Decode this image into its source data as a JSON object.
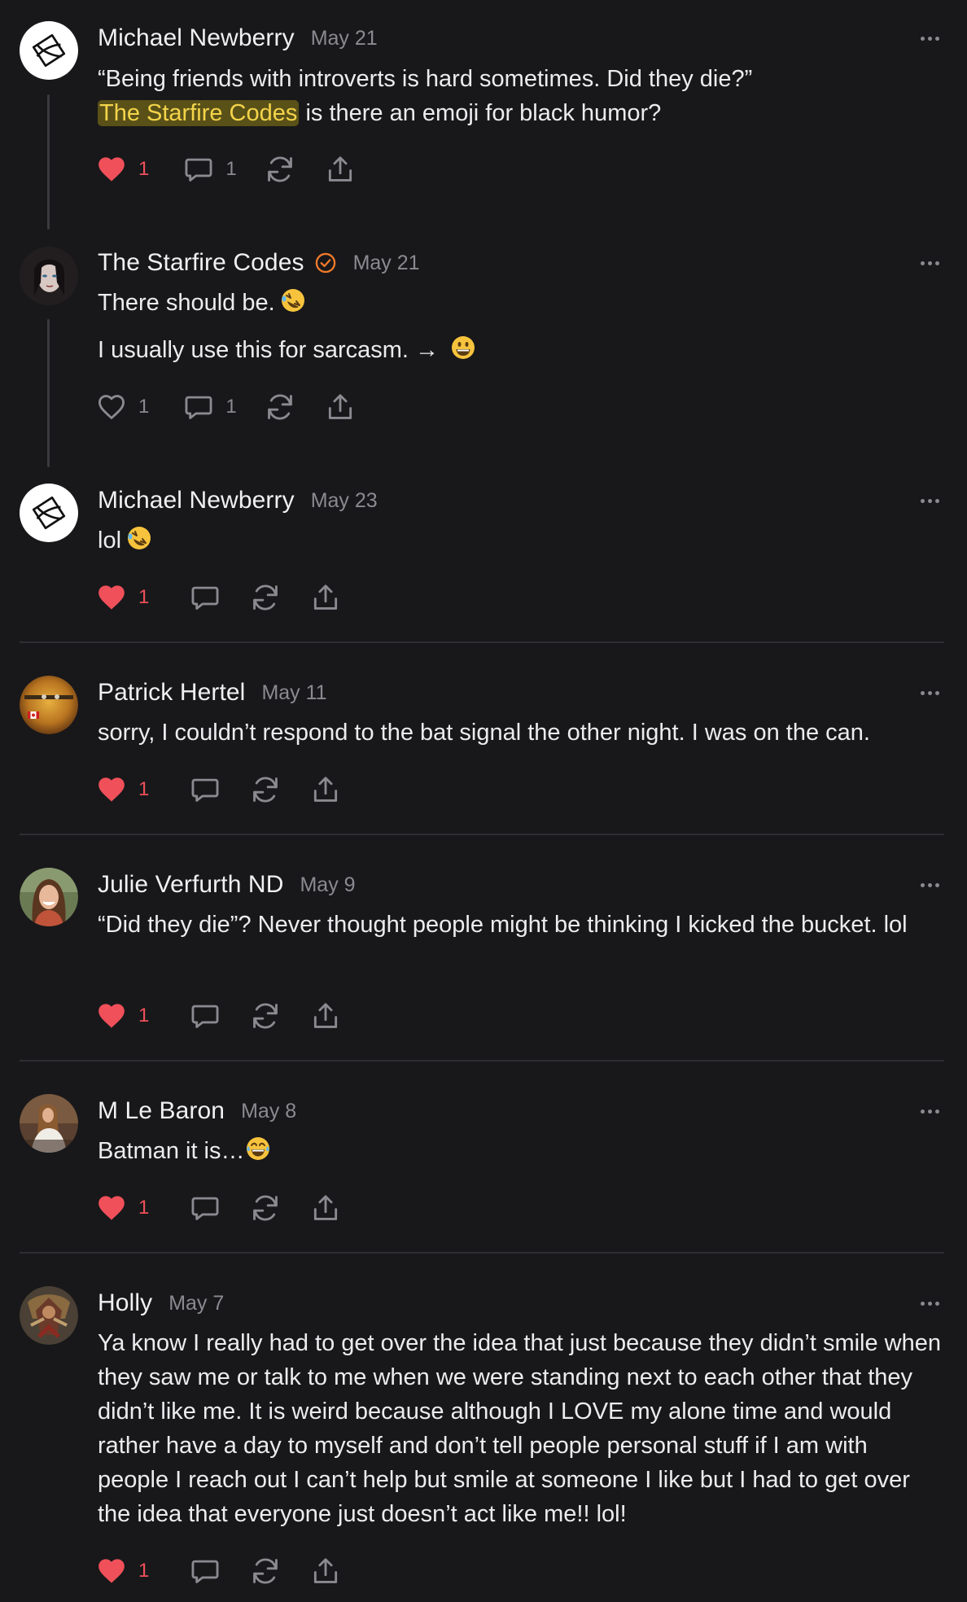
{
  "colors": {
    "background": "#18181a",
    "text": "#ececef",
    "muted": "#8a8a90",
    "like_red": "#f0505a",
    "mention_bg": "#5a5118",
    "mention_text": "#f4d44a",
    "verified_orange": "#f07a2a"
  },
  "icons": {
    "like": "heart-icon",
    "comment": "speech-bubble-icon",
    "restack": "restack-icon",
    "share": "share-icon",
    "more": "ellipsis-icon",
    "verified": "verified-badge-icon"
  },
  "comments": [
    {
      "author": "Michael Newberry",
      "date": "May 21",
      "line1": "“Being friends with introverts is hard sometimes. Did they die?”",
      "mention": "The Starfire Codes",
      "line2_rest": " is there an emoji for black humor?",
      "likes": "1",
      "liked": true,
      "replies": "1"
    },
    {
      "author": "The Starfire Codes",
      "date": "May 21",
      "para1": "There should be.",
      "para1_emoji": "rolling-on-floor-laughing-emoji",
      "para2": "I usually use this for sarcasm. → ",
      "para2_emoji": "grinning-face-emoji",
      "likes": "1",
      "liked": false,
      "replies": "1"
    },
    {
      "author": "Michael Newberry",
      "date": "May 23",
      "text": "lol",
      "emoji": "rolling-on-floor-laughing-emoji",
      "likes": "1",
      "liked": true
    },
    {
      "author": "Patrick Hertel",
      "date": "May 11",
      "text": "sorry, I couldn’t respond to the bat signal the other night. I was on the can.",
      "likes": "1",
      "liked": true
    },
    {
      "author": "Julie Verfurth ND",
      "date": "May 9",
      "text": "“Did they die”? Never thought people might be thinking I kicked the bucket. lol",
      "likes": "1",
      "liked": true
    },
    {
      "author": "M Le Baron",
      "date": "May 8",
      "text": "Batman it is…",
      "emoji": "face-with-tears-of-joy-emoji",
      "likes": "1",
      "liked": true
    },
    {
      "author": "Holly",
      "date": "May 7",
      "text": "Ya know I really had to get over the idea that just because they didn’t smile when they saw me or talk to me when we were standing next to each other that they didn’t like me. It is weird because although I LOVE my alone time and would rather have a day to myself and don’t tell people personal stuff if I am with people I reach out I can’t help but smile at someone I like but I had to get over the idea that everyone just doesn’t act like me!! lol!",
      "likes": "1",
      "liked": true
    }
  ]
}
